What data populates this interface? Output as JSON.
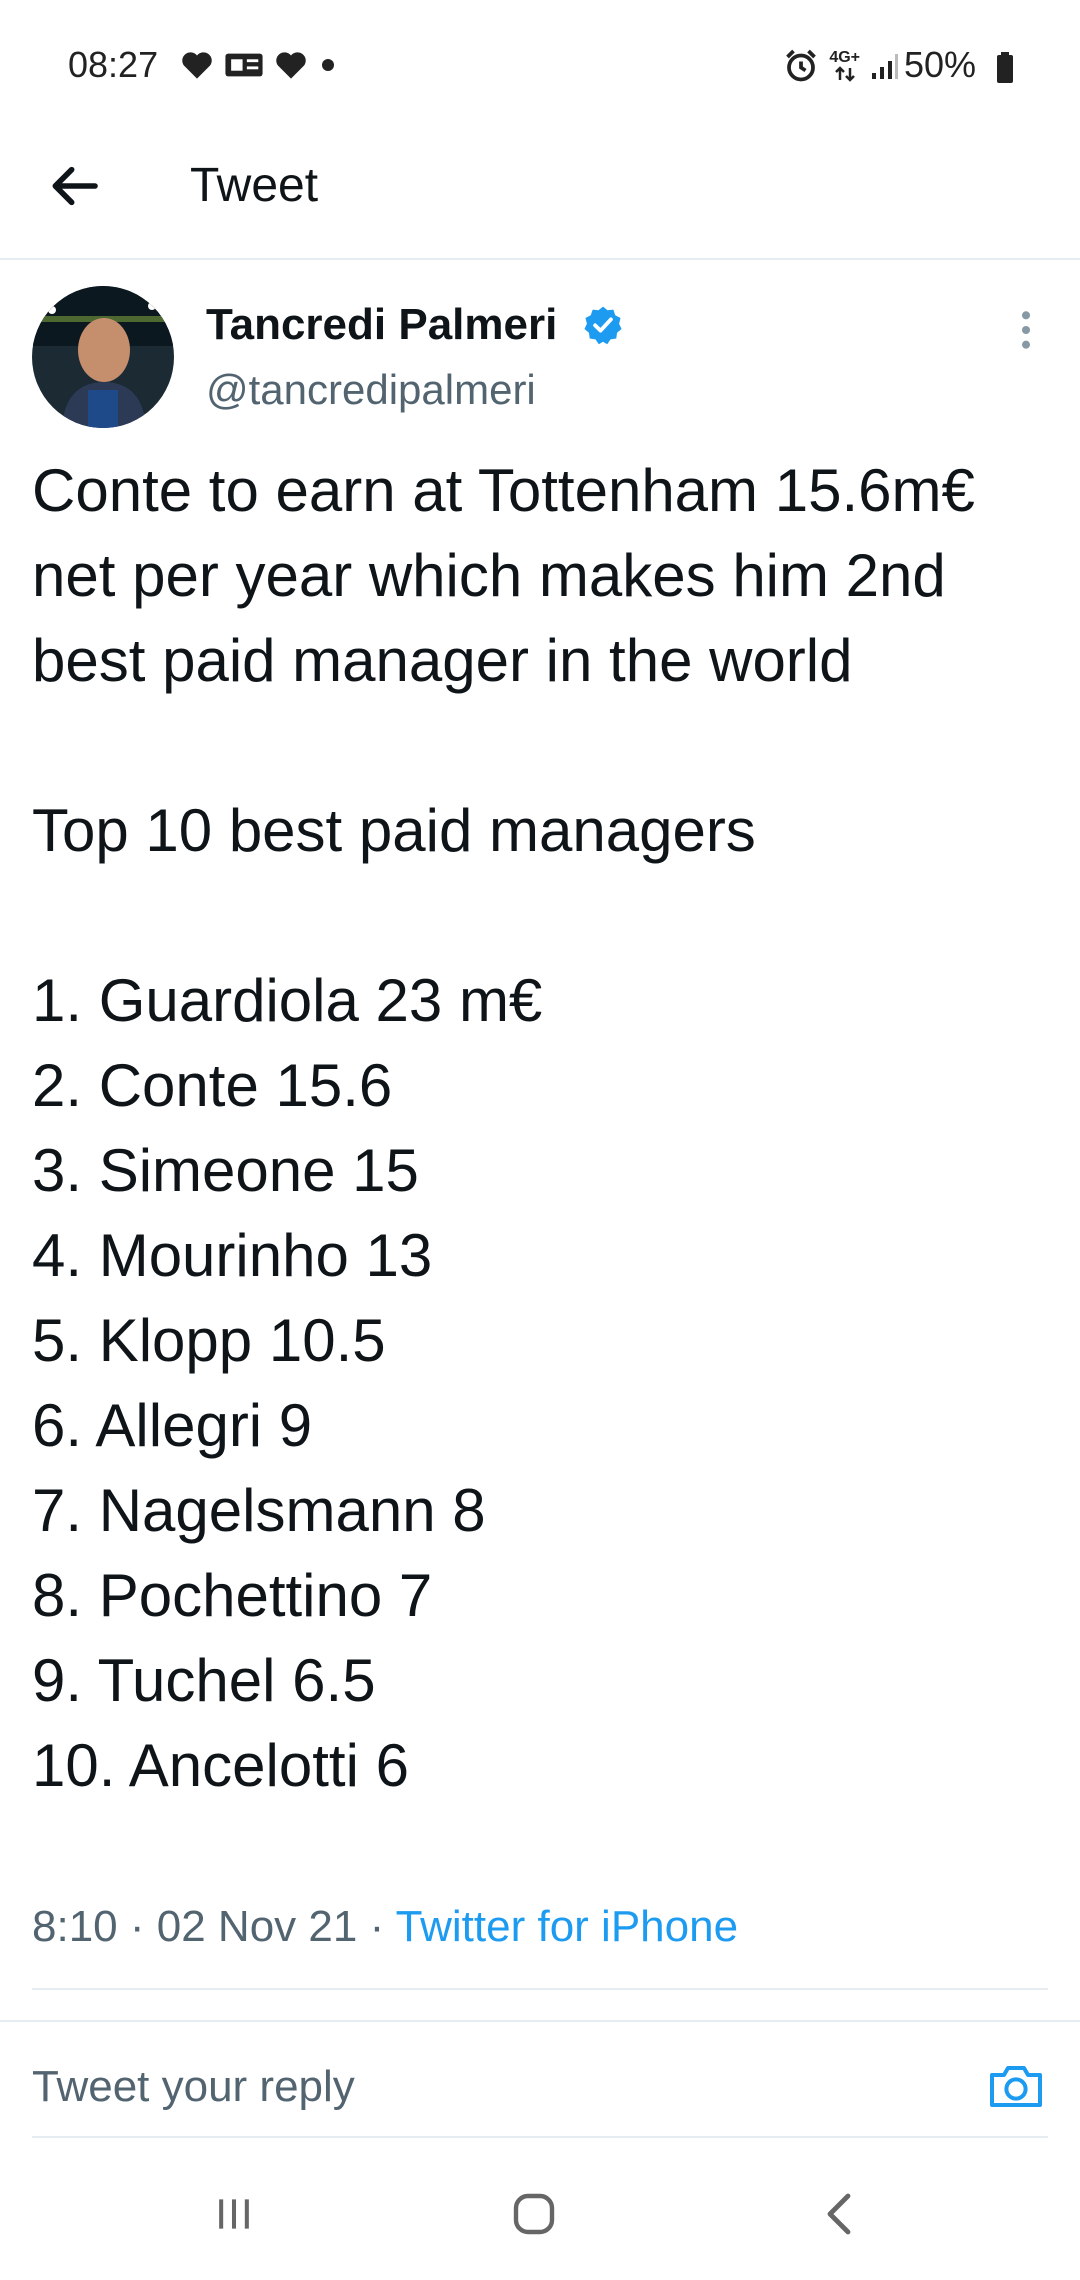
{
  "status_bar": {
    "time": "08:27",
    "network": "4G+",
    "battery": "50%",
    "left_icons": [
      "heart-icon",
      "ticket-icon",
      "heart-icon",
      "dot-icon"
    ],
    "right_icons": [
      "alarm-icon",
      "network-arrows-icon",
      "signal-icon"
    ]
  },
  "header": {
    "title": "Tweet",
    "back_icon": "back-arrow-icon"
  },
  "author": {
    "name": "Tancredi Palmeri",
    "handle": "@tancredipalmeri",
    "verified": true
  },
  "tweet": {
    "text": "Conte to earn at Tottenham 15.6m€ net per year which makes him 2nd best paid manager in the world\n\nTop 10 best paid managers\n\n1. Guardiola 23 m€\n2. Conte 15.6\n3. Simeone 15\n4. Mourinho 13\n5. Klopp 10.5\n6. Allegri 9\n7. Nagelsmann 8\n8. Pochettino 7\n9. Tuchel 6.5\n10. Ancelotti 6",
    "time": "8:10",
    "date": "02 Nov 21",
    "separator": "·",
    "source": "Twitter for iPhone"
  },
  "reply": {
    "placeholder": "Tweet your reply",
    "camera_icon": "camera-icon"
  },
  "nav": {
    "icons": [
      "recent-apps-icon",
      "home-icon",
      "back-icon"
    ]
  },
  "colors": {
    "accent": "#1d9bf0",
    "text": "#0f1419",
    "secondary": "#536471",
    "divider": "#e6ecf0"
  }
}
